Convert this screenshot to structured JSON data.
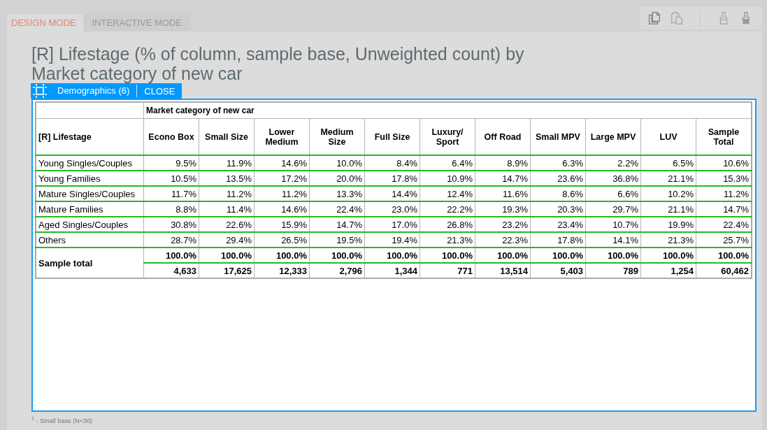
{
  "tabs": [
    {
      "label": "DESIGN MODE",
      "selected": true
    },
    {
      "label": "INTERACTIVE MODE",
      "selected": false
    }
  ],
  "title": "[R] Lifestage (% of column, sample base, Unweighted count) by Market category of new car",
  "selection": {
    "label": "Demographics (6)",
    "close": "CLOSE"
  },
  "table": {
    "column_group": "Market category of new car",
    "row_header_label": "[R] Lifestage",
    "columns": [
      "Econo Box",
      "Small Size",
      "Lower Medium",
      "Medium Size",
      "Full Size",
      "Luxury/ Sport",
      "Off Road",
      "Small MPV",
      "Large MPV",
      "LUV",
      "Sample Total"
    ],
    "rows": [
      {
        "label": "Young Singles/Couples",
        "values": [
          "9.5%",
          "11.9%",
          "14.6%",
          "10.0%",
          "8.4%",
          "6.4%",
          "8.9%",
          "6.3%",
          "2.2%",
          "6.5%",
          "10.6%"
        ]
      },
      {
        "label": "Young Families",
        "values": [
          "10.5%",
          "13.5%",
          "17.2%",
          "20.0%",
          "17.8%",
          "10.9%",
          "14.7%",
          "23.6%",
          "36.8%",
          "21.1%",
          "15.3%"
        ]
      },
      {
        "label": "Mature Singles/Couples",
        "values": [
          "11.7%",
          "11.2%",
          "11.2%",
          "13.3%",
          "14.4%",
          "12.4%",
          "11.6%",
          "8.6%",
          "6.6%",
          "10.2%",
          "11.2%"
        ]
      },
      {
        "label": "Mature Families",
        "values": [
          "8.8%",
          "11.4%",
          "14.6%",
          "22.4%",
          "23.0%",
          "22.2%",
          "19.3%",
          "20.3%",
          "29.7%",
          "21.1%",
          "14.7%"
        ]
      },
      {
        "label": "Aged Singles/Couples",
        "values": [
          "30.8%",
          "22.6%",
          "15.9%",
          "14.7%",
          "17.0%",
          "26.8%",
          "23.2%",
          "23.4%",
          "10.7%",
          "19.9%",
          "22.4%"
        ]
      },
      {
        "label": "Others",
        "values": [
          "28.7%",
          "29.4%",
          "26.5%",
          "19.5%",
          "19.4%",
          "21.3%",
          "22.3%",
          "17.8%",
          "14.1%",
          "21.3%",
          "25.7%"
        ]
      }
    ],
    "total": {
      "label": "Sample total",
      "percents": [
        "100.0%",
        "100.0%",
        "100.0%",
        "100.0%",
        "100.0%",
        "100.0%",
        "100.0%",
        "100.0%",
        "100.0%",
        "100.0%",
        "100.0%"
      ],
      "counts": [
        "4,633",
        "17,625",
        "12,333",
        "2,796",
        "1,344",
        "771",
        "13,514",
        "5,403",
        "789",
        "1,254",
        "60,462"
      ]
    }
  },
  "footnote": "$^{1}$ - Small base (N<30)"
}
